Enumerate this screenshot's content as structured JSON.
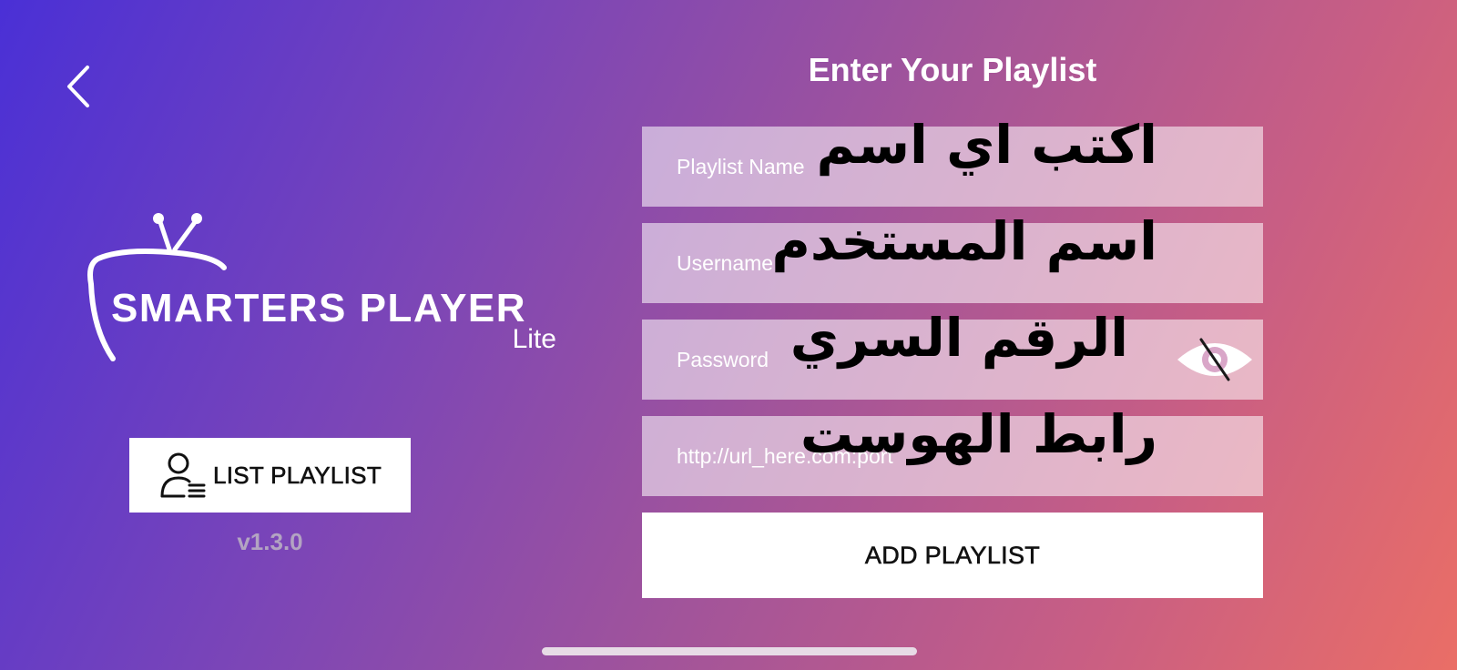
{
  "header": {
    "title": "Enter Your Playlist"
  },
  "icons": {
    "back": "chevron-left-icon",
    "logo": "tv-antenna-icon",
    "list_playlist": "user-list-icon",
    "password_visibility": "eye-slash-icon"
  },
  "logo": {
    "name": "SMARTERS PLAYER",
    "sub": "Lite"
  },
  "sidebar": {
    "list_button_label": "LIST PLAYLIST",
    "version": "v1.3.0"
  },
  "form": {
    "fields": [
      {
        "placeholder": "Playlist Name",
        "value": "",
        "overlay": "اكتب اي اسم"
      },
      {
        "placeholder": "Username",
        "value": "",
        "overlay": "اسم المستخدم"
      },
      {
        "placeholder": "Password",
        "value": "",
        "overlay": "الرقم السري"
      },
      {
        "placeholder": "http://url_here.com:port",
        "value": "",
        "overlay": "رابط الهوست"
      }
    ],
    "submit_label": "ADD PLAYLIST"
  },
  "colors": {
    "gradient_start": "#4a30d6",
    "gradient_end": "#ea6e66",
    "button_bg": "#ffffff",
    "field_bg": "rgba(255,255,255,0.55)",
    "version_text": "#b3a4c2"
  }
}
